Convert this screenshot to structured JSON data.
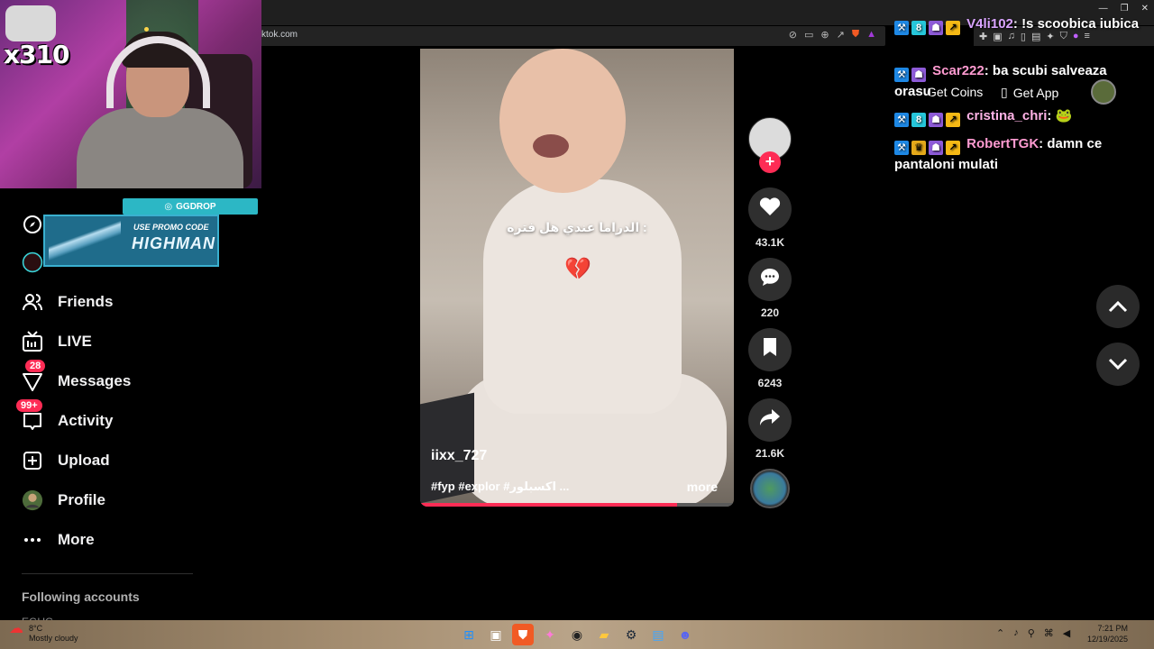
{
  "browser": {
    "url": "ktok.com"
  },
  "overlay": {
    "counter": "x310",
    "promo_brand": "GGDROP",
    "promo_line1": "USE PROMO CODE",
    "promo_line2": "HIGHMAN"
  },
  "sidebar": {
    "items": [
      {
        "label": "Friends",
        "icon": "friends-icon"
      },
      {
        "label": "LIVE",
        "icon": "live-icon"
      },
      {
        "label": "Messages",
        "icon": "messages-icon",
        "badge": "28"
      },
      {
        "label": "Activity",
        "icon": "activity-icon",
        "badge": "99+"
      },
      {
        "label": "Upload",
        "icon": "upload-icon"
      },
      {
        "label": "Profile",
        "icon": "profile-icon"
      },
      {
        "label": "More",
        "icon": "more-icon"
      }
    ],
    "following_header": "Following accounts",
    "following_partial": "EGUG"
  },
  "video": {
    "caption": "الدراما عندي هل فتره :",
    "emoji": "💔",
    "username": "iixx_727",
    "description": "#fyp #explor #اكسبلور ...",
    "more": "more",
    "progress": 0.82
  },
  "actions": {
    "likes": "43.1K",
    "comments": "220",
    "saves": "6243",
    "shares": "21.6K"
  },
  "header": {
    "get_coins": "Get Coins",
    "get_app": "Get App"
  },
  "chat": [
    {
      "user": "V4li102",
      "text": "!s scoobica iubica",
      "color": "#d9a4ff"
    },
    {
      "user": "Scar222",
      "text": "ba scubi salveaza orasu",
      "color": "#ff9bd1"
    },
    {
      "user": "cristina_chri",
      "text": "🐸",
      "color": "#ffb3e6"
    },
    {
      "user": "RobertTGK",
      "text": "damn ce pantaloni mulati",
      "color": "#ff9bd1"
    }
  ],
  "taskbar": {
    "temp": "8°C",
    "weather": "Mostly cloudy",
    "time": "7:21 PM",
    "date": "12/19/2025"
  },
  "colors": {
    "accent": "#fe2c55",
    "background": "#000000"
  }
}
